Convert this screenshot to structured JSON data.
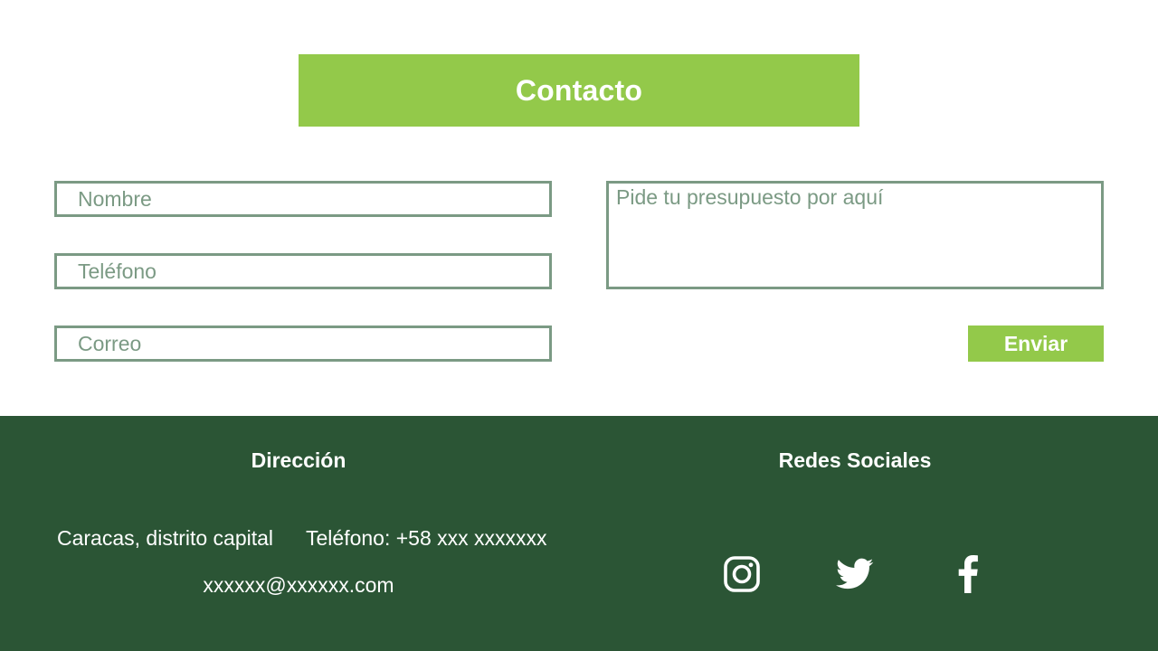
{
  "header": {
    "title": "Contacto"
  },
  "form": {
    "name_placeholder": "Nombre",
    "phone_placeholder": "Teléfono",
    "email_placeholder": "Correo",
    "message_placeholder": "Pide tu presupuesto por aquí",
    "send_label": "Enviar"
  },
  "footer": {
    "address_heading": "Dirección",
    "social_heading": "Redes Sociales",
    "city": "Caracas, distrito capital",
    "phone": "Teléfono: +58 xxx xxxxxxx",
    "email": "xxxxxx@xxxxxx.com",
    "social_icons": [
      "instagram-icon",
      "twitter-icon",
      "facebook-icon"
    ]
  },
  "colors": {
    "accent_green": "#93c94a",
    "footer_green": "#2b5535",
    "border_green": "#7b9a84",
    "white": "#ffffff"
  }
}
